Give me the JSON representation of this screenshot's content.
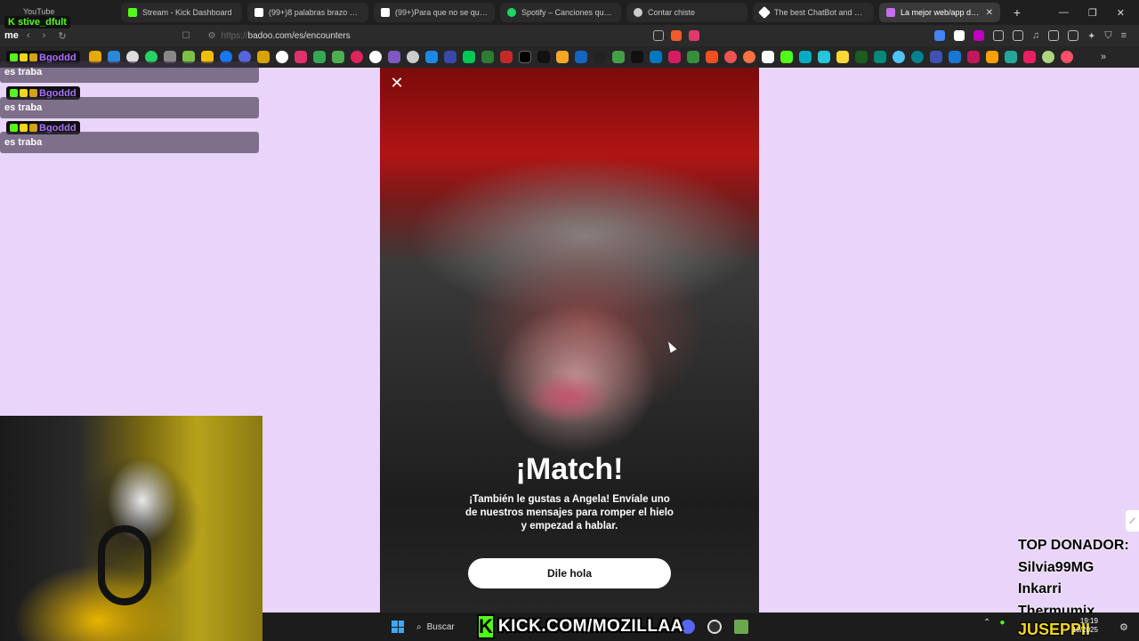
{
  "browser": {
    "tabs": [
      {
        "title": "Stream - Kick Dashboard",
        "color": "#53fc18"
      },
      {
        "title": "(99+)8 palabras brazo miserable",
        "color": "#ffffff"
      },
      {
        "title": "(99+)Para que no se quedara",
        "color": "#ffffff"
      },
      {
        "title": "Spotify – Canciones que te gustan",
        "color": "#1ed760"
      },
      {
        "title": "Contar chiste",
        "color": "#cccccc"
      },
      {
        "title": "The best ChatBot and Widgets",
        "color": "#ffffff"
      },
      {
        "title": "La mejor web/app de citas",
        "color": "#c56ef0"
      }
    ],
    "ghost_tab": "YouTube",
    "url_scheme": "https://",
    "url_host": "badoo.com/es/encounters",
    "new_tab": "+",
    "win_min": "—",
    "win_max": "❐",
    "win_close": "✕"
  },
  "chat": {
    "top_user": "stive_dfult",
    "me_label": "me",
    "messages": [
      {
        "user": "Bgoddd",
        "text": "es traba"
      },
      {
        "user": "Bgoddd",
        "text": "es traba"
      },
      {
        "user": "Bgoddd",
        "text": "es traba"
      }
    ]
  },
  "match": {
    "title": "¡Match!",
    "subtitle": "¡También le gustas a Angela! Envíale uno de nuestros mensajes para romper el hielo y empezad a hablar.",
    "button": "Dile hola",
    "close": "✕"
  },
  "donor": {
    "heading": "TOP DONADOR:",
    "names": [
      "Silvia99MG",
      "Inkarri",
      "Thermumix"
    ]
  },
  "taskbar": {
    "search_label": "Buscar",
    "kick_banner": "KICK.COM/MOZILLAA",
    "kick_logo": "K",
    "lang": "ESP",
    "time": "19:19",
    "date": "10/2025",
    "streamer": "JUSEPPII"
  },
  "colors": {
    "page_bg": "#e9d5f9",
    "kick_green": "#53fc18",
    "chat_username": "#a970ff"
  }
}
